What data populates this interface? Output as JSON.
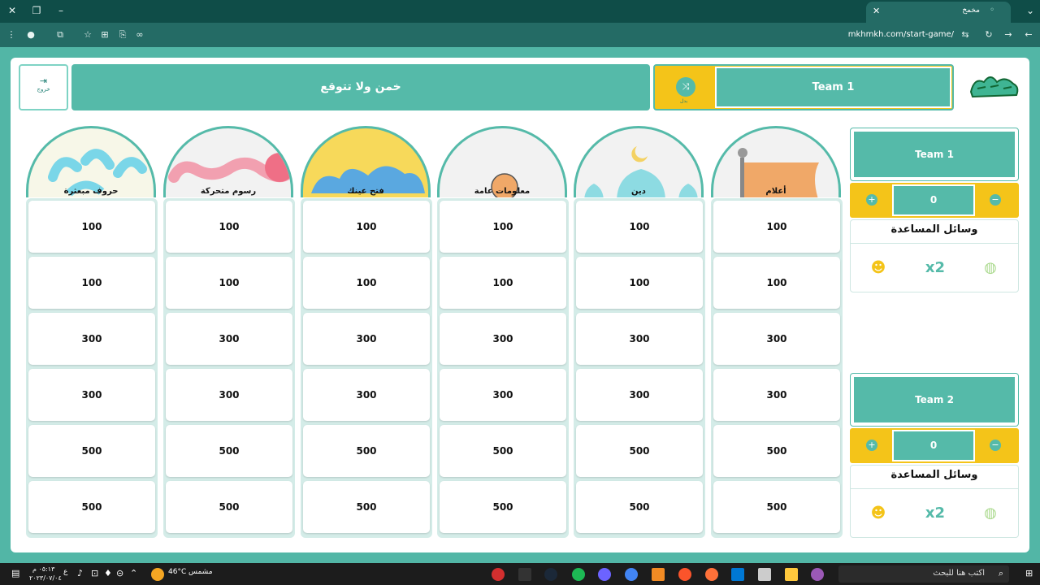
{
  "browser": {
    "tab_title": "مخمخ",
    "url": "mkhmkh.com/start-game/"
  },
  "header": {
    "exit_label": "خروج",
    "game_name": "خمن ولا تتوقع",
    "swap_label": "بدل",
    "current_team": "Team 1"
  },
  "categories": [
    {
      "title": "حروف مبعثرة",
      "cells": [
        "100",
        "100",
        "300",
        "300",
        "500",
        "500"
      ]
    },
    {
      "title": "رسوم متحركة",
      "cells": [
        "100",
        "100",
        "300",
        "300",
        "500",
        "500"
      ]
    },
    {
      "title": "فتح عينك",
      "cells": [
        "100",
        "100",
        "300",
        "300",
        "500",
        "500"
      ]
    },
    {
      "title": "معلومات عامة",
      "cells": [
        "100",
        "100",
        "300",
        "300",
        "500",
        "500"
      ]
    },
    {
      "title": "دين",
      "cells": [
        "100",
        "100",
        "300",
        "300",
        "500",
        "500"
      ]
    },
    {
      "title": "أعلام",
      "cells": [
        "100",
        "100",
        "300",
        "300",
        "500",
        "500"
      ]
    }
  ],
  "teams": [
    {
      "name": "Team 1",
      "score": "0",
      "help_title": "وسائل المساعدة",
      "minus": "−",
      "plus": "+",
      "x2": "x2"
    },
    {
      "name": "Team 2",
      "score": "0",
      "help_title": "وسائل المساعدة",
      "minus": "−",
      "plus": "+",
      "x2": "x2"
    }
  ],
  "sponsor": "zain",
  "taskbar": {
    "search_placeholder": "اكتب هنا للبحث",
    "weather_text": "مشمس",
    "temperature": "46°C",
    "time": "٠٥:١٣ م",
    "date": "٢٠٢٣/٠٧/٠٤",
    "lang": "ع"
  },
  "colors": {
    "teal": "#55baa9",
    "yellow": "#f4c419",
    "browser_dark": "#0f4d48"
  }
}
